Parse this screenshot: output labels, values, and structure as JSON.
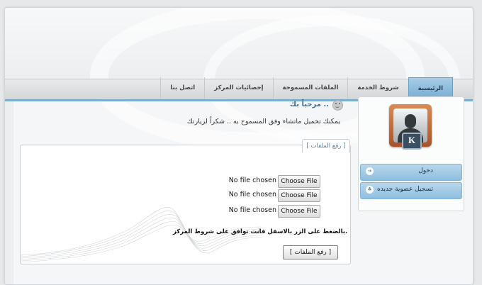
{
  "nav": {
    "tabs": [
      {
        "label": "الرئيسية",
        "active": true
      },
      {
        "label": "شروط الخدمة",
        "active": false
      },
      {
        "label": "الملفات المسموحة",
        "active": false
      },
      {
        "label": "إحصائيات المركز",
        "active": false
      },
      {
        "label": "اتصل بنا",
        "active": false
      }
    ]
  },
  "sidebar": {
    "avatar_badge": "K",
    "login_label": "دخول",
    "register_label": "تسجيل عضوية جديده"
  },
  "welcome": {
    "title": "مرحباً بك ..",
    "subtitle": "يمكنك تحميل ماتشاء وفق المسموح به .. شكراً لزيارتك"
  },
  "upload": {
    "tab_label": "[ رفع الملفات ]",
    "choose_label": "Choose File",
    "no_file": "No file chosen",
    "notice": "بالضغط على الزر بالاسفل فانت توافق على شروط المركز.",
    "submit_label": "[ رفع الملفات ]"
  },
  "colors": {
    "accent": "#7aaed0",
    "button": "#9ec8e3"
  }
}
